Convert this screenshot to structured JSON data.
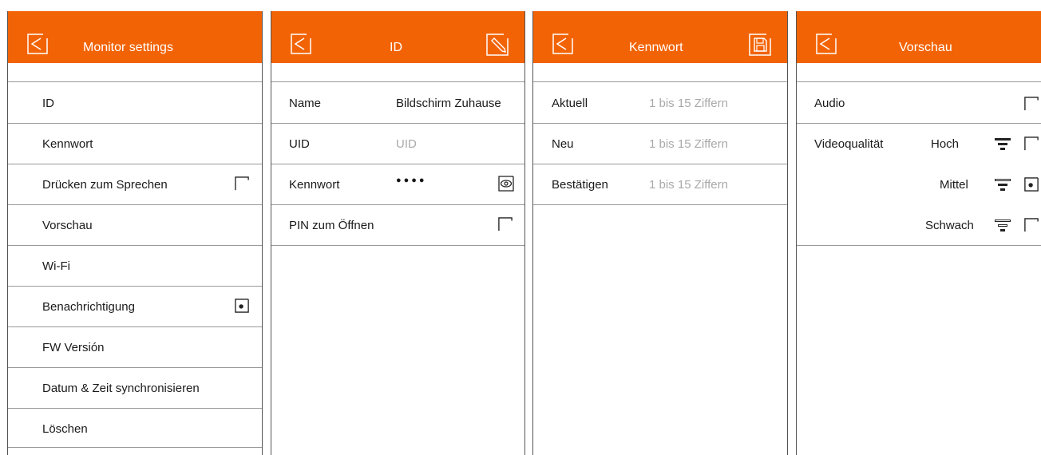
{
  "monitor_settings": {
    "title": "Monitor settings",
    "items": [
      {
        "label": "ID"
      },
      {
        "label": "Kennwort"
      },
      {
        "label": "Drücken zum Sprechen",
        "control": "checkbox",
        "checked": false
      },
      {
        "label": "Vorschau"
      },
      {
        "label": "Wi-Fi"
      },
      {
        "label": "Benachrichtigung",
        "control": "checkbox",
        "checked": true
      },
      {
        "label": "FW Versión"
      },
      {
        "label": "Datum & Zeit synchronisieren"
      },
      {
        "label": "Löschen"
      }
    ]
  },
  "id_screen": {
    "title": "ID",
    "right_icon": "edit-icon",
    "rows": [
      {
        "label": "Name",
        "value": "Bildschirm Zuhause"
      },
      {
        "label": "UID",
        "placeholder": "UID"
      },
      {
        "label": "Kennwort",
        "value": "●●●●",
        "icon": "eye-icon"
      },
      {
        "label": "PIN zum Öffnen",
        "control": "checkbox",
        "checked": false
      }
    ]
  },
  "kennwort_screen": {
    "title": "Kennwort",
    "right_icon": "save-icon",
    "rows": [
      {
        "label": "Aktuell",
        "placeholder": "1 bis 15 Ziffern"
      },
      {
        "label": "Neu",
        "placeholder": "1 bis 15 Ziffern"
      },
      {
        "label": "Bestätigen",
        "placeholder": "1 bis 15 Ziffern"
      }
    ]
  },
  "vorschau_screen": {
    "title": "Vorschau",
    "audio_label": "Audio",
    "audio_checked": false,
    "video_label": "Videoqualität",
    "quality_options": [
      {
        "label": "Hoch",
        "icon": "quality-high-icon",
        "checked": false
      },
      {
        "label": "Mittel",
        "icon": "quality-medium-icon",
        "checked": true
      },
      {
        "label": "Schwach",
        "icon": "quality-low-icon",
        "checked": false
      }
    ]
  },
  "colors": {
    "header": "#f26305",
    "separator": "#999999",
    "placeholder": "#a9a9a9"
  }
}
